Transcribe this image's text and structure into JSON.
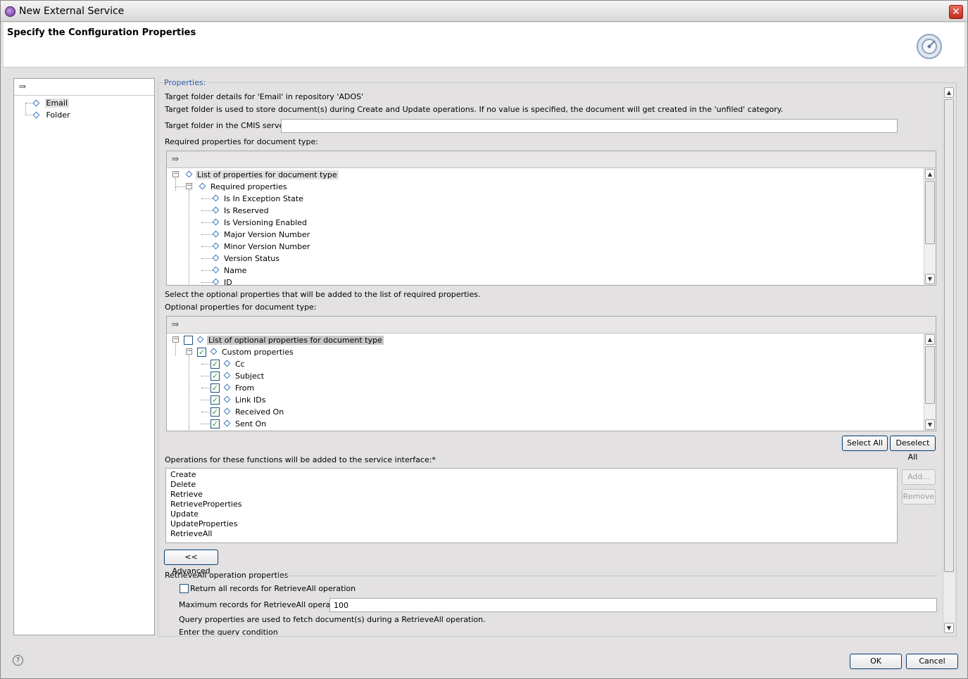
{
  "window": {
    "title": "New External Service",
    "close_glyph": "✕"
  },
  "header": {
    "heading": "Specify the Configuration Properties"
  },
  "left_tree": {
    "items": [
      {
        "label": "Email"
      },
      {
        "label": "Folder"
      }
    ]
  },
  "properties": {
    "legend": "Properties:",
    "target_details": "Target folder details for 'Email' in repository  'ADOS'",
    "target_note": "Target folder is used to store document(s) during Create and Update operations. If no value is specified, the document will get created in the 'unfiled' category.",
    "target_folder_label": "Target folder in the CMIS server:",
    "target_folder_value": "",
    "required_label": "Required properties for document type:",
    "required_tree": {
      "root": "List of properties for document type",
      "group": "Required properties",
      "items": [
        "Is In Exception State",
        "Is Reserved",
        "Is Versioning Enabled",
        "Major Version Number",
        "Minor Version Number",
        "Version Status",
        "Name",
        "ID"
      ]
    },
    "optional_hint": "Select the optional properties that will be added to the list of required properties.",
    "optional_label": "Optional properties for document type:",
    "optional_tree": {
      "root": "List of optional properties for document type",
      "root_checked": false,
      "group": "Custom properties",
      "group_checked": true,
      "items": [
        {
          "label": "Cc",
          "checked": true
        },
        {
          "label": "Subject",
          "checked": true
        },
        {
          "label": "From",
          "checked": true
        },
        {
          "label": "Link IDs",
          "checked": true
        },
        {
          "label": "Received On",
          "checked": true
        },
        {
          "label": "Sent On",
          "checked": true
        }
      ]
    },
    "select_all": "Select All",
    "deselect_all": "Deselect All",
    "operations_label": "Operations for these functions will be added to the service interface:*",
    "operations": [
      "Create",
      "Delete",
      "Retrieve",
      "RetrieveProperties",
      "Update",
      "UpdateProperties",
      "RetrieveAll"
    ],
    "add_button": "Add...",
    "remove_button": "Remove",
    "advanced_button": "<< Advanced",
    "retrieveall_section": "RetrieveAll operation properties",
    "return_all_label": "Return all records for RetrieveAll operation",
    "return_all_checked": false,
    "max_records_label": "Maximum records for RetrieveAll operation:",
    "max_records_value": "100",
    "query_note": "Query properties are used to fetch document(s) during a RetrieveAll operation.",
    "query_condition_label": "Enter the query condition"
  },
  "footer": {
    "help_glyph": "?",
    "ok": "OK",
    "cancel": "Cancel"
  },
  "icons": {
    "app": "app-icon",
    "wizard": "wizard-banner-icon",
    "collapse": "collapse-all-icon",
    "help": "help-icon"
  }
}
